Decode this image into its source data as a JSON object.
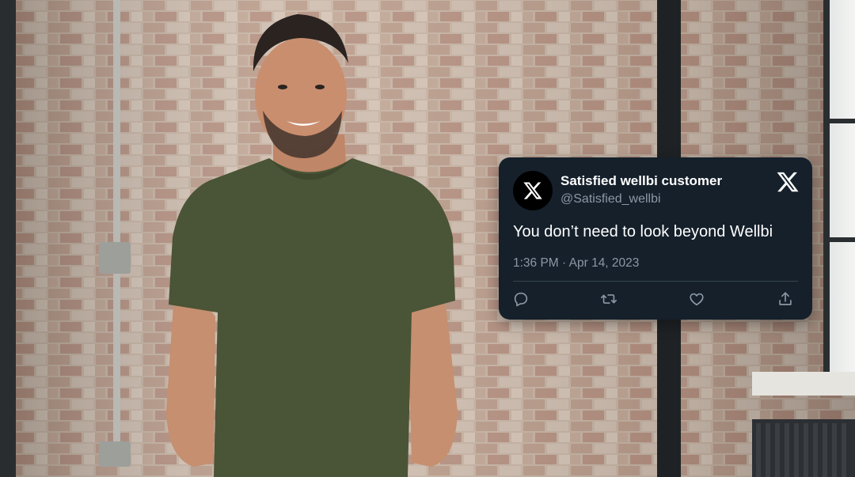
{
  "tweet": {
    "display_name": "Satisfied wellbi customer",
    "handle": "@Satisfied_wellbi",
    "text": "You don’t need to look beyond Wellbi",
    "timestamp": "1:36 PM · Apr 14, 2023",
    "avatar_icon": "x-logo-icon",
    "brand_icon": "x-logo-icon",
    "actions": [
      {
        "icon": "reply-icon"
      },
      {
        "icon": "retweet-icon"
      },
      {
        "icon": "like-icon"
      },
      {
        "icon": "share-icon"
      }
    ]
  },
  "colors": {
    "card_background": "#15202b",
    "primary_text": "#ffffff",
    "secondary_text": "#8b98a5",
    "divider": "#38444d",
    "avatar_background": "#000000"
  }
}
